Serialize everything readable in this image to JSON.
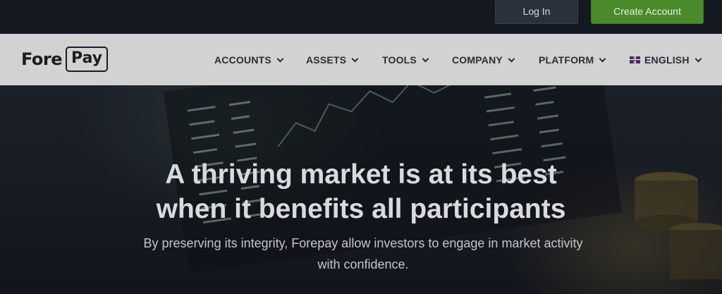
{
  "topbar": {
    "login_label": "Log In",
    "create_account_label": "Create Account",
    "create_color": "#4a8a2a"
  },
  "nav": {
    "logo": {
      "part1": "Fore",
      "part2": "Pay"
    },
    "items": [
      {
        "label": "ACCOUNTS"
      },
      {
        "label": "ASSETS"
      },
      {
        "label": "TOOLS"
      },
      {
        "label": "COMPANY"
      },
      {
        "label": "PLATFORM"
      }
    ],
    "language": {
      "label": "ENGLISH",
      "icon": "uk-flag-icon"
    }
  },
  "hero": {
    "title_line1": "A thriving market is at its best",
    "title_line2": "when it benefits all participants",
    "subtitle_line1": "By preserving its integrity, Forepay allow investors to engage in market activity",
    "subtitle_line2": "with confidence."
  }
}
